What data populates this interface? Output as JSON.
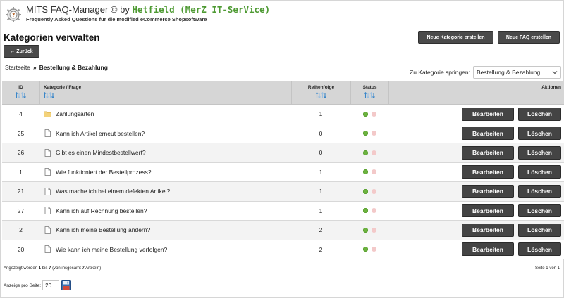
{
  "header": {
    "title_prefix": "MITS FAQ-Manager © by ",
    "title_author": "Hetfield (MerZ IT-SerVice)",
    "subtitle": "Frequently Asked Questions für die modified eCommerce Shopsoftware"
  },
  "page": {
    "title": "Kategorien verwalten",
    "new_category_label": "Neue Kategorie erstellen",
    "new_faq_label": "Neue FAQ erstellen",
    "back_label": "← Zurück"
  },
  "breadcrumb": {
    "home": "Startseite",
    "separator": "»",
    "current": "Bestellung & Bezahlung"
  },
  "jump": {
    "label": "Zu Kategorie springen:",
    "selected": "Bestellung & Bezahlung"
  },
  "table": {
    "headers": {
      "id": "ID",
      "category": "Kategorie / Frage",
      "order": "Reihenfolge",
      "status": "Status",
      "actions": "Aktionen"
    },
    "edit_label": "Bearbeiten",
    "delete_label": "Löschen",
    "rows": [
      {
        "id": "4",
        "type": "folder",
        "title": "Zahlungsarten",
        "order": "1",
        "status": "active"
      },
      {
        "id": "25",
        "type": "file",
        "title": "Kann ich Artikel erneut bestellen?",
        "order": "0",
        "status": "active"
      },
      {
        "id": "26",
        "type": "file",
        "title": "Gibt es einen Mindestbestellwert?",
        "order": "0",
        "status": "active"
      },
      {
        "id": "1",
        "type": "file",
        "title": "Wie funktioniert der Bestellprozess?",
        "order": "1",
        "status": "active"
      },
      {
        "id": "21",
        "type": "file",
        "title": "Was mache ich bei einem defekten Artikel?",
        "order": "1",
        "status": "active"
      },
      {
        "id": "27",
        "type": "file",
        "title": "Kann ich auf Rechnung bestellen?",
        "order": "1",
        "status": "active"
      },
      {
        "id": "2",
        "type": "file",
        "title": "Kann ich meine Bestellung ändern?",
        "order": "2",
        "status": "active"
      },
      {
        "id": "20",
        "type": "file",
        "title": "Wie kann ich meine Bestellung verfolgen?",
        "order": "2",
        "status": "active"
      }
    ]
  },
  "footer": {
    "shown_prefix": "Angezeigt werden ",
    "shown_from": "1",
    "shown_mid": " bis ",
    "shown_to": "7",
    "shown_total_prefix": " (von insgesamt ",
    "shown_total": "7",
    "shown_suffix": " Artikeln)",
    "pages": "Seite 1 von 1",
    "per_page_label": "Anzeige pro Seite:",
    "per_page_value": "20"
  },
  "colors": {
    "status_on": "#6cb33f",
    "status_off": "#f3c9c9",
    "button_dark": "#444444",
    "header_bg": "#d6d6d6",
    "brand_green": "#4e9a33"
  },
  "icons": {
    "logo": "gear-question-icon",
    "sort": "sort-arrows-icon",
    "folder": "folder-icon",
    "file": "document-icon",
    "save": "floppy-disk-icon",
    "chevron": "chevron-down-icon"
  }
}
